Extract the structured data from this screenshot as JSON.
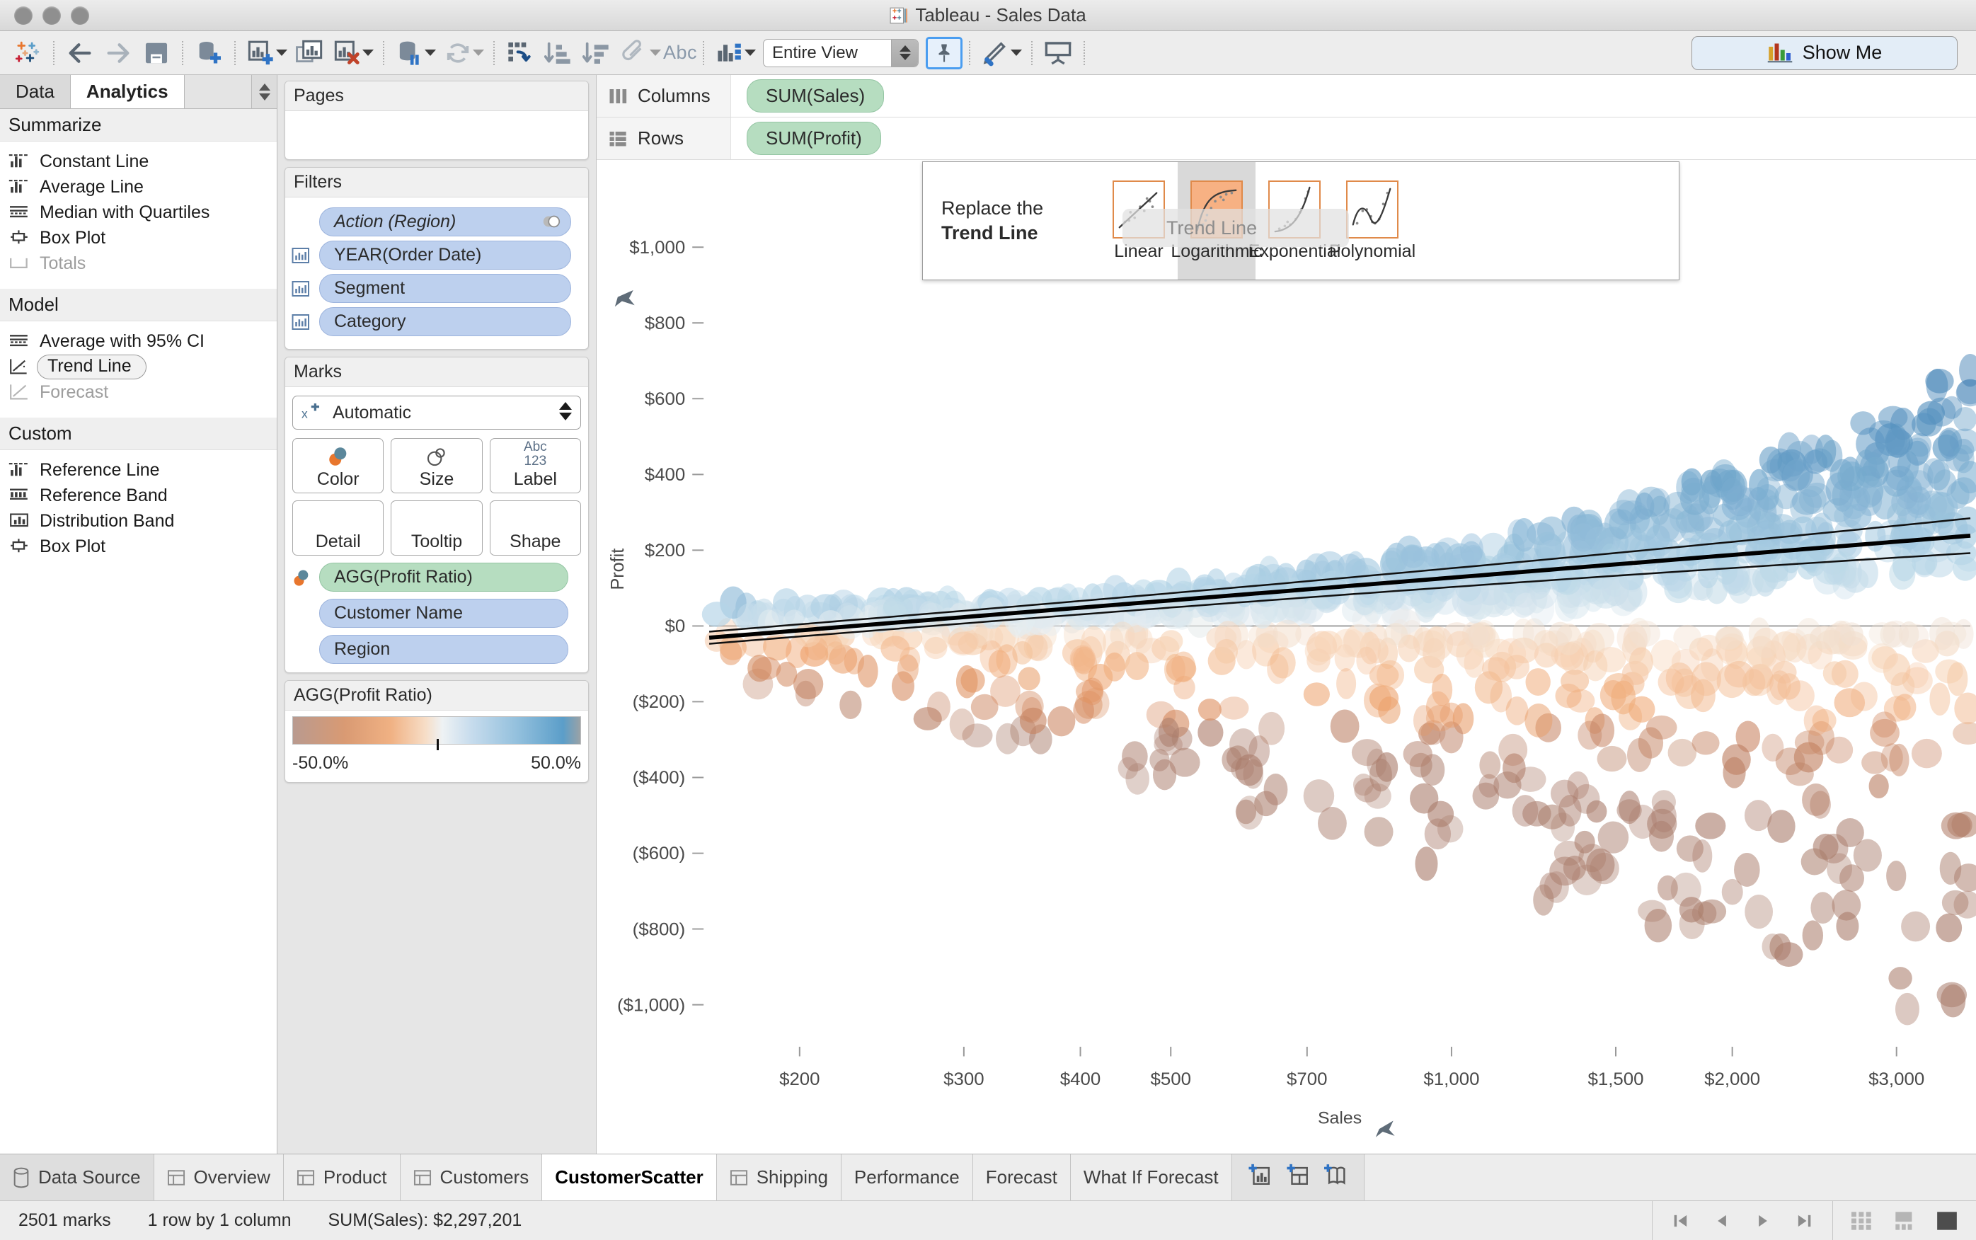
{
  "window": {
    "title": "Tableau - Sales Data",
    "app_icon": "tableau-logo-icon"
  },
  "toolbar": {
    "items": [
      {
        "name": "tableau-home-icon",
        "label": "Tableau Home"
      },
      {
        "name": "back-icon",
        "label": "Back"
      },
      {
        "name": "forward-icon",
        "label": "Forward"
      },
      {
        "name": "save-icon",
        "label": "Save"
      },
      {
        "name": "new-data-source-icon",
        "label": "New Data Source"
      },
      {
        "name": "new-worksheet-icon",
        "label": "New Worksheet"
      },
      {
        "name": "duplicate-sheet-icon",
        "label": "Duplicate Sheet"
      },
      {
        "name": "clear-sheet-icon",
        "label": "Clear Sheet"
      },
      {
        "name": "pause-auto-update-icon",
        "label": "Pause Auto Updates"
      },
      {
        "name": "refresh-icon",
        "label": "Run Update"
      },
      {
        "name": "swap-rows-columns-icon",
        "label": "Swap Rows and Columns"
      },
      {
        "name": "sort-ascending-icon",
        "label": "Sort Ascending"
      },
      {
        "name": "sort-descending-icon",
        "label": "Sort Descending"
      },
      {
        "name": "highlight-icon",
        "label": "Highlight"
      },
      {
        "name": "labels-icon",
        "label": "Show Mark Labels"
      },
      {
        "name": "fit-icon",
        "label": "Fit"
      },
      {
        "name": "fix-axes-icon",
        "label": "Fix Axes"
      },
      {
        "name": "format-icon",
        "label": "Format"
      },
      {
        "name": "presentation-mode-icon",
        "label": "Presentation Mode"
      }
    ],
    "labels_text": "Abc",
    "fit_value": "Entire View",
    "show_me_label": "Show Me"
  },
  "left_pane": {
    "tabs": [
      {
        "label": "Data",
        "active": false
      },
      {
        "label": "Analytics",
        "active": true
      }
    ],
    "sections": [
      {
        "title": "Summarize",
        "items": [
          {
            "label": "Constant Line",
            "icon": "constant-line-icon",
            "disabled": false,
            "dragging": false
          },
          {
            "label": "Average Line",
            "icon": "average-line-icon",
            "disabled": false,
            "dragging": false
          },
          {
            "label": "Median with Quartiles",
            "icon": "median-quartiles-icon",
            "disabled": false,
            "dragging": false
          },
          {
            "label": "Box Plot",
            "icon": "box-plot-icon",
            "disabled": false,
            "dragging": false
          },
          {
            "label": "Totals",
            "icon": "totals-icon",
            "disabled": true,
            "dragging": false
          }
        ]
      },
      {
        "title": "Model",
        "items": [
          {
            "label": "Average with 95% CI",
            "icon": "average-ci-icon",
            "disabled": false,
            "dragging": false
          },
          {
            "label": "Trend Line",
            "icon": "trend-line-icon",
            "disabled": false,
            "dragging": true
          },
          {
            "label": "Forecast",
            "icon": "forecast-icon",
            "disabled": true,
            "dragging": false
          }
        ]
      },
      {
        "title": "Custom",
        "items": [
          {
            "label": "Reference Line",
            "icon": "reference-line-icon",
            "disabled": false,
            "dragging": false
          },
          {
            "label": "Reference Band",
            "icon": "reference-band-icon",
            "disabled": false,
            "dragging": false
          },
          {
            "label": "Distribution Band",
            "icon": "distribution-band-icon",
            "disabled": false,
            "dragging": false
          },
          {
            "label": "Box Plot",
            "icon": "box-plot-icon",
            "disabled": false,
            "dragging": false
          }
        ]
      }
    ]
  },
  "cards": {
    "pages": {
      "title": "Pages",
      "items": []
    },
    "filters": {
      "title": "Filters",
      "items": [
        {
          "label": "Action (Region)",
          "icon": null,
          "italic": true,
          "badge": "action-filter-icon"
        },
        {
          "label": "YEAR(Order Date)",
          "icon": "dimension-icon",
          "italic": false
        },
        {
          "label": "Segment",
          "icon": "dimension-icon",
          "italic": false
        },
        {
          "label": "Category",
          "icon": "dimension-icon",
          "italic": false
        }
      ]
    },
    "marks": {
      "title": "Marks",
      "mark_type": "Automatic",
      "mark_type_icon": "automatic-shape-icon",
      "buttons": [
        {
          "label": "Color",
          "icon": "color-icon"
        },
        {
          "label": "Size",
          "icon": "size-icon"
        },
        {
          "label": "Label",
          "icon": "label-icon",
          "sub": "Abc",
          "sub2": "123"
        },
        {
          "label": "Detail",
          "icon": "detail-icon"
        },
        {
          "label": "Tooltip",
          "icon": "tooltip-icon"
        },
        {
          "label": "Shape",
          "icon": "shape-icon"
        }
      ],
      "pills": [
        {
          "label": "AGG(Profit Ratio)",
          "type": "green",
          "icon": "color-icon"
        },
        {
          "label": "Customer Name",
          "type": "blue",
          "icon": null
        },
        {
          "label": "Region",
          "type": "blue",
          "icon": null
        }
      ]
    },
    "legend": {
      "title": "AGG(Profit Ratio)",
      "min_label": "-50.0%",
      "max_label": "50.0%",
      "colors": {
        "low": "#b99a8f",
        "mid_low": "#f0b183",
        "mid": "#eef2f4",
        "mid_high": "#93c0dd",
        "high": "#5b9ec9"
      }
    }
  },
  "shelves": {
    "columns": {
      "label": "Columns",
      "icon": "columns-icon",
      "pills": [
        {
          "label": "SUM(Sales)",
          "type": "green"
        }
      ]
    },
    "rows": {
      "label": "Rows",
      "icon": "rows-icon",
      "pills": [
        {
          "label": "SUM(Profit)",
          "type": "green"
        }
      ]
    }
  },
  "trend_popup": {
    "prompt_line1": "Replace the",
    "prompt_line2": "Trend Line",
    "ghost_drag_label": "Trend Line",
    "options": [
      {
        "label": "Linear",
        "selected": false,
        "icon": "linear-trend-thumb"
      },
      {
        "label": "Logarithmic",
        "selected": true,
        "icon": "logarithmic-trend-thumb"
      },
      {
        "label": "Exponential",
        "selected": false,
        "icon": "exponential-trend-thumb"
      },
      {
        "label": "Polynomial",
        "selected": false,
        "icon": "polynomial-trend-thumb"
      }
    ]
  },
  "chart_data": {
    "type": "scatter",
    "title": "",
    "xlabel": "Sales",
    "ylabel": "Profit",
    "x_scale": "log",
    "y_scale": "linear",
    "x_tick_labels": [
      "$200",
      "$300",
      "$400",
      "$500",
      "$700",
      "$1,000",
      "$1,500",
      "$2,000",
      "$3,000"
    ],
    "x_tick_values": [
      200,
      300,
      400,
      500,
      700,
      1000,
      1500,
      2000,
      3000
    ],
    "y_tick_labels": [
      "$1,000",
      "$800",
      "$600",
      "$400",
      "$200",
      "$0",
      "($200)",
      "($400)",
      "($600)",
      "($800)",
      "($1,000)"
    ],
    "y_tick_values": [
      1000,
      800,
      600,
      400,
      200,
      0,
      -200,
      -400,
      -600,
      -800,
      -1000
    ],
    "ylim": [
      -1100,
      1100
    ],
    "xlim": [
      160,
      3600
    ],
    "grid": false,
    "marks_count": 2501,
    "color_field": "AGG(Profit Ratio)",
    "color_range": [
      -0.5,
      0.5
    ],
    "trend": {
      "model": "Logarithmic",
      "confidence": "95%",
      "has_confidence_bands": true
    },
    "series": [
      {
        "name": "Customer Name / Region",
        "point_count": 2501,
        "encoding": {
          "x": "SUM(Sales)",
          "y": "SUM(Profit)",
          "color": "AGG(Profit Ratio)"
        }
      }
    ]
  },
  "worksheet_tabs": {
    "data_source": {
      "label": "Data Source",
      "icon": "data-source-icon"
    },
    "sheets": [
      {
        "label": "Overview",
        "icon": "sheet-icon",
        "active": false
      },
      {
        "label": "Product",
        "icon": "sheet-icon",
        "active": false
      },
      {
        "label": "Customers",
        "icon": "sheet-icon",
        "active": false
      },
      {
        "label": "CustomerScatter",
        "icon": null,
        "active": true
      },
      {
        "label": "Shipping",
        "icon": "sheet-icon",
        "active": false
      },
      {
        "label": "Performance",
        "icon": null,
        "active": false
      },
      {
        "label": "Forecast",
        "icon": null,
        "active": false
      },
      {
        "label": "What If Forecast",
        "icon": null,
        "active": false
      }
    ],
    "new_buttons": [
      {
        "name": "new-worksheet-icon",
        "label": "New Worksheet"
      },
      {
        "name": "new-dashboard-icon",
        "label": "New Dashboard"
      },
      {
        "name": "new-story-icon",
        "label": "New Story"
      }
    ]
  },
  "status_bar": {
    "marks": "2501 marks",
    "dimensions": "1 row by 1 column",
    "aggregate": "SUM(Sales): $2,297,201",
    "nav": [
      {
        "name": "first-page-icon"
      },
      {
        "name": "prev-page-icon"
      },
      {
        "name": "next-page-icon"
      },
      {
        "name": "last-page-icon"
      }
    ],
    "view_modes": [
      {
        "name": "grid-view-icon"
      },
      {
        "name": "list-view-icon"
      },
      {
        "name": "full-view-icon"
      }
    ]
  }
}
